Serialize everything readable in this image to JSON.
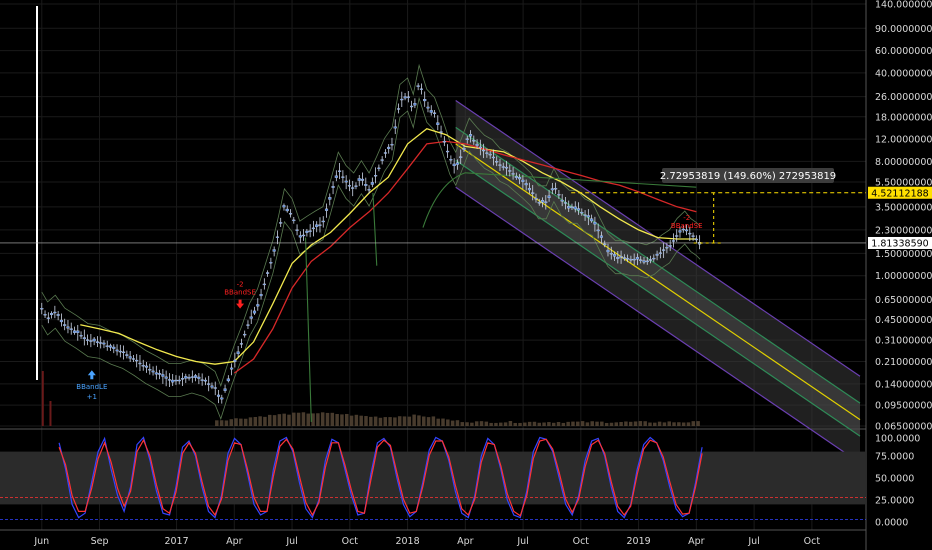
{
  "colors": {
    "background": "#000000",
    "grid": "#1a1a1a",
    "candle": "#5b8ad8",
    "sma_short": "#f2e94e",
    "sma_long": "#d62828",
    "bollinger": "#5a7a50",
    "volume": "#5a4a38",
    "channel_fill": "#3a3a3a",
    "channel_outer": "#6a3fb0",
    "channel_mid": "#2e8b57",
    "channel_center": "#e0d000",
    "stoch_k": "#3344ff",
    "stoch_d": "#ff3333",
    "stoch_band": "#2b2b2b",
    "measure_box": "#3c3c3c",
    "current_price_tag": "#ffffff",
    "target_tag": "#ffe000",
    "sell_signal": "#ff2020",
    "buy_signal": "#4aa3ff"
  },
  "header": {
    "measure_text": "2.72953819 (149.60%) 272953819",
    "current_price": "1.81338590",
    "target_price": "4.52112188"
  },
  "signals": {
    "buy": {
      "label": "BBandLE",
      "value": "+1"
    },
    "sell": {
      "label": "BBandSE",
      "value": "-2"
    },
    "sell_2": {
      "label": "BBandSE",
      "value": "-2"
    }
  },
  "chart_data": [
    {
      "type": "line",
      "scale": "log",
      "price_ticks": [
        "140.00000000",
        "90.00000000",
        "60.00000000",
        "40.00000000",
        "26.00000000",
        "18.00000000",
        "12.00000000",
        "8.00000000",
        "5.50000000",
        "3.50000000",
        "2.30000000",
        "1.50000000",
        "1.00000000",
        "0.65000000",
        "0.45000000",
        "0.31000000",
        "0.21000000",
        "0.14000000",
        "0.09500000",
        "0.06500000"
      ],
      "price_tick_values": [
        140,
        90,
        60,
        40,
        26,
        18,
        12,
        8,
        5.5,
        3.5,
        2.3,
        1.5,
        1.0,
        0.65,
        0.45,
        0.31,
        0.21,
        0.14,
        0.095,
        0.065
      ],
      "time_ticks": [
        "Jun",
        "Sep",
        "2017",
        "Apr",
        "Jul",
        "Oct",
        "2018",
        "Apr",
        "Jul",
        "Oct",
        "2019",
        "Apr",
        "Jul",
        "Oct"
      ],
      "time_tick_months": [
        0,
        3,
        7,
        10,
        13,
        16,
        19,
        22,
        25,
        28,
        31,
        34,
        37,
        40
      ],
      "ylim": [
        0.065,
        140
      ],
      "xlim_months": [
        -0.3,
        42.5
      ],
      "series": [
        {
          "kind": "price",
          "points": [
            [
              0,
              0.55
            ],
            [
              0.3,
              0.46
            ],
            [
              0.7,
              0.52
            ],
            [
              1.2,
              0.41
            ],
            [
              1.8,
              0.36
            ],
            [
              2.4,
              0.31
            ],
            [
              3,
              0.3
            ],
            [
              3.6,
              0.27
            ],
            [
              4.2,
              0.25
            ],
            [
              4.8,
              0.22
            ],
            [
              5.4,
              0.19
            ],
            [
              6,
              0.17
            ],
            [
              6.6,
              0.15
            ],
            [
              7.2,
              0.15
            ],
            [
              7.8,
              0.16
            ],
            [
              8.4,
              0.15
            ],
            [
              9,
              0.13
            ],
            [
              9.3,
              0.1
            ],
            [
              9.6,
              0.14
            ],
            [
              10,
              0.21
            ],
            [
              10.4,
              0.3
            ],
            [
              10.8,
              0.45
            ],
            [
              11.2,
              0.58
            ],
            [
              11.6,
              0.9
            ],
            [
              12,
              1.4
            ],
            [
              12.3,
              2.2
            ],
            [
              12.6,
              3.6
            ],
            [
              13,
              3.0
            ],
            [
              13.4,
              2.0
            ],
            [
              13.8,
              2.2
            ],
            [
              14.2,
              2.4
            ],
            [
              14.6,
              2.6
            ],
            [
              15,
              4.2
            ],
            [
              15.4,
              7.0
            ],
            [
              15.8,
              5.5
            ],
            [
              16.2,
              4.8
            ],
            [
              16.6,
              6.0
            ],
            [
              17,
              4.8
            ],
            [
              17.4,
              6.5
            ],
            [
              17.8,
              9.0
            ],
            [
              18.2,
              11.0
            ],
            [
              18.6,
              24
            ],
            [
              19,
              27
            ],
            [
              19.3,
              20
            ],
            [
              19.6,
              34
            ],
            [
              20,
              22
            ],
            [
              20.4,
              19
            ],
            [
              20.8,
              13
            ],
            [
              21.2,
              8.5
            ],
            [
              21.5,
              7.0
            ],
            [
              21.8,
              9
            ],
            [
              22.2,
              13
            ],
            [
              22.6,
              11
            ],
            [
              23,
              9.5
            ],
            [
              23.4,
              8.8
            ],
            [
              23.8,
              7.5
            ],
            [
              24.2,
              7.0
            ],
            [
              24.6,
              6.2
            ],
            [
              25,
              5.5
            ],
            [
              25.4,
              4.8
            ],
            [
              25.8,
              3.8
            ],
            [
              26.2,
              3.8
            ],
            [
              26.6,
              5.2
            ],
            [
              27,
              4.0
            ],
            [
              27.4,
              3.5
            ],
            [
              27.8,
              3.5
            ],
            [
              28.2,
              3.0
            ],
            [
              28.6,
              2.8
            ],
            [
              29,
              2.1
            ],
            [
              29.4,
              1.6
            ],
            [
              29.8,
              1.4
            ],
            [
              30.2,
              1.4
            ],
            [
              30.6,
              1.35
            ],
            [
              31,
              1.35
            ],
            [
              31.4,
              1.3
            ],
            [
              31.8,
              1.38
            ],
            [
              32.2,
              1.55
            ],
            [
              32.6,
              1.7
            ],
            [
              33,
              2.1
            ],
            [
              33.4,
              2.4
            ],
            [
              33.7,
              2.1
            ],
            [
              34,
              1.95
            ],
            [
              34.2,
              1.82
            ]
          ]
        },
        {
          "kind": "sma_short",
          "points": [
            [
              2,
              0.41
            ],
            [
              3,
              0.38
            ],
            [
              4,
              0.35
            ],
            [
              5,
              0.3
            ],
            [
              6,
              0.26
            ],
            [
              7,
              0.23
            ],
            [
              8,
              0.21
            ],
            [
              9,
              0.2
            ],
            [
              10,
              0.21
            ],
            [
              11,
              0.3
            ],
            [
              12,
              0.6
            ],
            [
              13,
              1.25
            ],
            [
              14,
              1.75
            ],
            [
              15,
              2.2
            ],
            [
              16,
              3.1
            ],
            [
              17,
              4.5
            ],
            [
              18,
              6.0
            ],
            [
              19,
              11.0
            ],
            [
              20,
              14.5
            ],
            [
              21,
              13.0
            ],
            [
              22,
              10.5
            ],
            [
              23,
              10.0
            ],
            [
              24,
              9.5
            ],
            [
              25,
              8.0
            ],
            [
              26,
              6.5
            ],
            [
              27,
              5.5
            ],
            [
              28,
              4.5
            ],
            [
              29,
              3.5
            ],
            [
              30,
              2.8
            ],
            [
              31,
              2.3
            ],
            [
              32,
              2.0
            ],
            [
              33,
              1.95
            ],
            [
              34,
              1.95
            ]
          ]
        },
        {
          "kind": "sma_long",
          "points": [
            [
              10,
              0.17
            ],
            [
              11,
              0.22
            ],
            [
              12,
              0.38
            ],
            [
              13,
              0.8
            ],
            [
              14,
              1.3
            ],
            [
              15,
              1.7
            ],
            [
              16,
              2.4
            ],
            [
              17,
              3.2
            ],
            [
              18,
              4.5
            ],
            [
              19,
              7.0
            ],
            [
              20,
              11.0
            ],
            [
              21,
              11.5
            ],
            [
              22,
              11.0
            ],
            [
              23,
              10.0
            ],
            [
              24,
              9.0
            ],
            [
              25,
              8.2
            ],
            [
              26,
              7.5
            ],
            [
              27,
              6.8
            ],
            [
              28,
              6.2
            ],
            [
              29,
              5.6
            ],
            [
              30,
              5.2
            ],
            [
              31,
              4.6
            ],
            [
              32,
              4.0
            ],
            [
              33,
              3.5
            ],
            [
              34,
              3.2
            ]
          ]
        },
        {
          "kind": "regression_channel",
          "start": [
            21.5,
            11.0
          ],
          "end": [
            42.5,
            0.073
          ],
          "outer_factor": 2.2,
          "mid_factor": 1.35
        }
      ],
      "annotations": [
        {
          "type": "price_line",
          "value": 1.8134
        },
        {
          "type": "target_line",
          "from_month": 27.5,
          "to_month": 35.2,
          "value": 4.5211
        },
        {
          "type": "measure",
          "month": 34.9,
          "from": 1.8134,
          "to": 4.5211
        },
        {
          "type": "buy_signal",
          "month": 2.6,
          "value": 0.2
        },
        {
          "type": "sell_signal",
          "month": 10.3,
          "value": 0.55
        },
        {
          "type": "sell_signal",
          "month": 33.5,
          "value": 2.05
        }
      ]
    },
    {
      "type": "line",
      "title": "",
      "ylim": [
        0,
        100
      ],
      "ticks": [
        "100.0000",
        "75.0000",
        "50.0000",
        "25.0000",
        "0.0000"
      ],
      "tick_values": [
        100,
        75,
        50,
        25,
        0
      ],
      "band": [
        20,
        80
      ],
      "reference_line": 28,
      "series": [
        {
          "kind": "stoch_k",
          "values": [
            90,
            60,
            20,
            5,
            10,
            45,
            80,
            95,
            60,
            30,
            12,
            40,
            88,
            96,
            70,
            35,
            10,
            8,
            40,
            85,
            92,
            75,
            40,
            12,
            5,
            30,
            78,
            95,
            88,
            55,
            20,
            8,
            12,
            60,
            92,
            96,
            80,
            45,
            15,
            5,
            25,
            70,
            94,
            90,
            60,
            30,
            8,
            10,
            55,
            90,
            95,
            85,
            50,
            20,
            6,
            12,
            45,
            82,
            96,
            92,
            70,
            35,
            10,
            5,
            30,
            75,
            95,
            88,
            60,
            25,
            8,
            5,
            35,
            80,
            96,
            94,
            80,
            50,
            20,
            8,
            30,
            70,
            92,
            95,
            75,
            40,
            12,
            5,
            20,
            60,
            88,
            96,
            90,
            70,
            40,
            15,
            6,
            10,
            45,
            85
          ]
        },
        {
          "kind": "stoch_d",
          "values": [
            85,
            65,
            30,
            12,
            12,
            38,
            72,
            90,
            68,
            38,
            18,
            35,
            80,
            93,
            75,
            42,
            15,
            10,
            34,
            78,
            90,
            78,
            46,
            18,
            8,
            26,
            70,
            90,
            88,
            60,
            28,
            12,
            12,
            52,
            86,
            94,
            83,
            52,
            22,
            8,
            22,
            62,
            90,
            90,
            65,
            36,
            12,
            10,
            48,
            85,
            93,
            87,
            56,
            26,
            10,
            12,
            40,
            76,
            92,
            92,
            74,
            42,
            15,
            8,
            26,
            68,
            90,
            88,
            64,
            32,
            12,
            7,
            30,
            72,
            92,
            94,
            83,
            56,
            26,
            11,
            26,
            63,
            88,
            93,
            78,
            46,
            18,
            8,
            18,
            54,
            83,
            93,
            90,
            74,
            46,
            20,
            9,
            10,
            40,
            78
          ]
        }
      ]
    }
  ]
}
